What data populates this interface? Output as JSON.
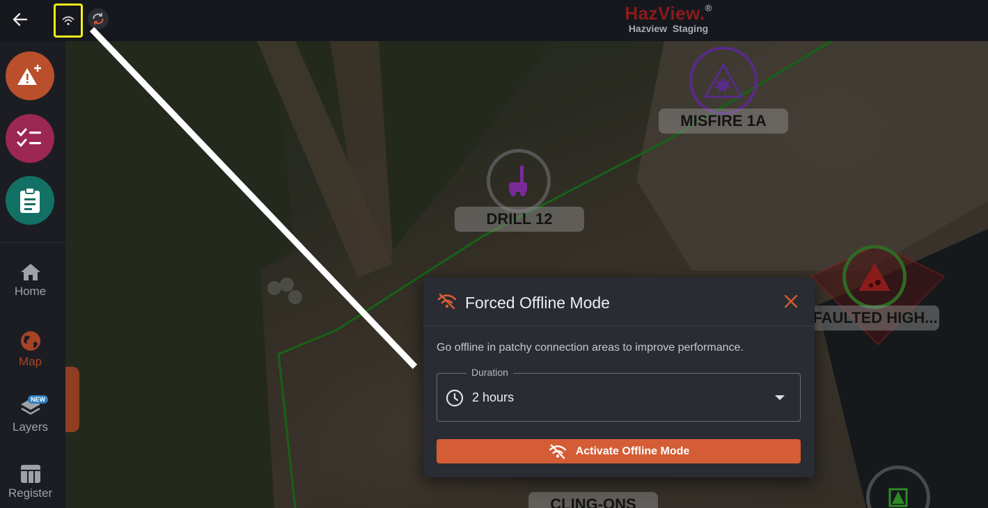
{
  "topbar": {
    "brand": "HazView.",
    "brand_mark": "®",
    "environment": "Hazview  Staging"
  },
  "sidebar": {
    "actions": [
      {
        "name": "add-hazard",
        "icon": "warning-plus-icon",
        "color": "#b9502b"
      },
      {
        "name": "tasks",
        "icon": "checklist-icon",
        "color": "#9c2752"
      },
      {
        "name": "forms",
        "icon": "clipboard-icon",
        "color": "#127065"
      }
    ],
    "nav": [
      {
        "label": "Home",
        "icon": "home-icon",
        "active": false
      },
      {
        "label": "Map",
        "icon": "globe-icon",
        "active": true
      },
      {
        "label": "Layers",
        "icon": "layers-icon",
        "active": false,
        "badge": "NEW"
      },
      {
        "label": "Register",
        "icon": "table-icon",
        "active": false
      }
    ]
  },
  "map": {
    "markers": [
      {
        "label": "MISFIRE 1A",
        "icon": "explosion-warning-icon",
        "ring_color": "#5a2a8a"
      },
      {
        "label": "DRILL 12",
        "icon": "drill-rig-icon",
        "ring_color": "#5b5b5b"
      },
      {
        "label": "FAULTED HIGH...",
        "icon": "rockfall-icon",
        "ring_color": "#2f6a25"
      },
      {
        "label": "CLING-ONS",
        "icon": "hazard-icon",
        "ring_color": "#5a2a8a"
      }
    ]
  },
  "dialog": {
    "title": "Forced Offline Mode",
    "description": "Go offline in patchy connection areas to improve performance.",
    "duration_label": "Duration",
    "duration_value": "2 hours",
    "activate_label": "Activate Offline Mode",
    "accent": "#d45d35"
  }
}
